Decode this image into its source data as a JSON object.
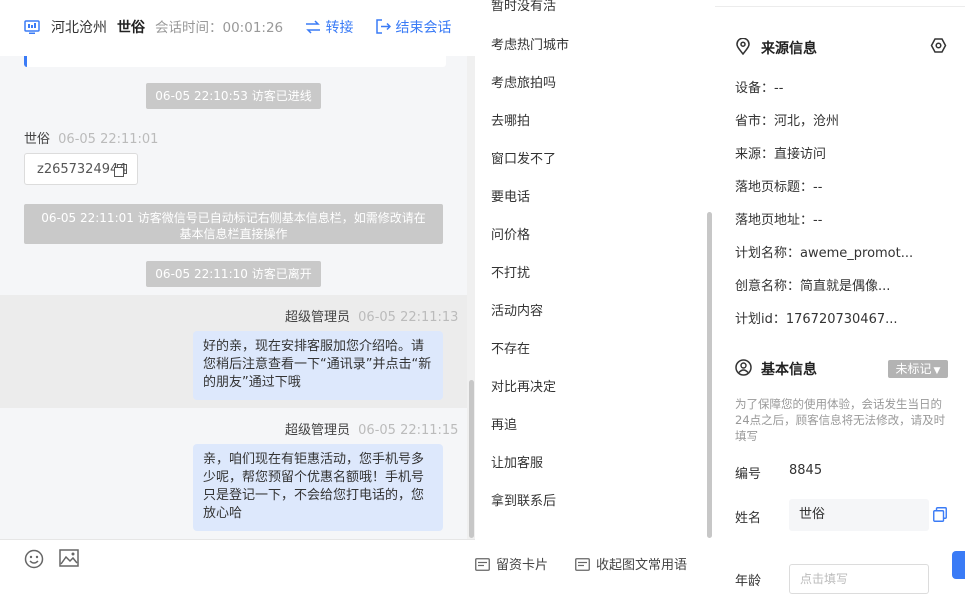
{
  "header": {
    "location": "河北沧州",
    "visitor_name": "世俗",
    "duration_label": "会话时间：",
    "duration": "00:01:26",
    "transfer_label": "转接",
    "end_label": "结束会话"
  },
  "chat": {
    "sys_entered": "06-05 22:10:53 访客已进线",
    "visitor_sender": "世俗",
    "visitor_time": "06-05 22:11:01",
    "visitor_message": "z2657324944",
    "sys_wechat": "06-05 22:11:01 访客微信号已自动标记右侧基本信息栏，如需修改请在基本信息栏直接操作",
    "sys_left": "06-05 22:11:10 访客已离开",
    "messages": [
      {
        "sender": "超级管理员",
        "time": "06-05 22:11:13",
        "text": "好的亲，现在安排客服加您介绍哈。请您稍后注意查看一下“通讯录”并点击“新的朋友”通过下哦"
      },
      {
        "sender": "超级管理员",
        "time": "06-05 22:11:15",
        "text": "亲，咱们现在有钜惠活动，您手机号多少呢，帮您预留个优惠名额哦！手机号只是登记一下，不会给您打电话的，您放心哈"
      }
    ]
  },
  "phrases": {
    "items": [
      "暂时没有活",
      "考虑热门城市",
      "考虑旅拍吗",
      "去哪拍",
      "窗口发不了",
      "要电话",
      "问价格",
      "不打扰",
      "活动内容",
      "不存在",
      "对比再决定",
      "再追",
      "让加客服",
      "拿到联系后"
    ],
    "leave_card": "留资卡片",
    "collapse_label": "收起图文常用语"
  },
  "source_info": {
    "title": "来源信息",
    "rows": [
      "设备：--",
      "省市：河北，沧州",
      "来源：直接访问",
      "落地页标题：--",
      "落地页地址：--",
      "计划名称：aweme_promot...",
      "创意名称：简直就是偶像...",
      "计划id：176720730467..."
    ]
  },
  "basic_info": {
    "title": "基本信息",
    "badge": "未标记",
    "note": "为了保障您的使用体验，会话发生当日的24点之后，顾客信息将无法修改，请及时填写",
    "id_label": "编号",
    "id_value": "8845",
    "name_label": "姓名",
    "name_value": "世俗",
    "age_label": "年龄",
    "age_placeholder": "点击填写"
  },
  "colors": {
    "accent": "#3a7bf6",
    "bubble": "#dde8fc",
    "system_tag": "#c9c9c9"
  }
}
